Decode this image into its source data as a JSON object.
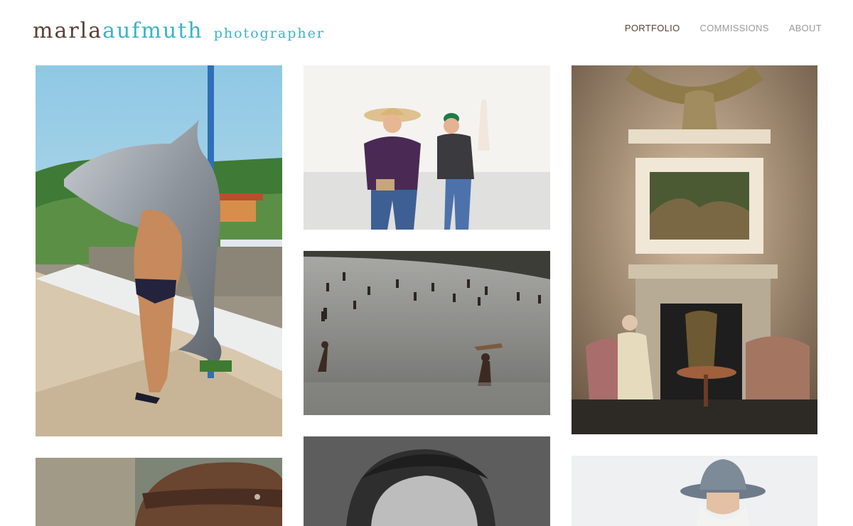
{
  "site": {
    "logo_first": "marla",
    "logo_last": "aufmuth",
    "logo_role": "photographer"
  },
  "nav": [
    {
      "label": "PORTFOLIO",
      "active": true
    },
    {
      "label": "COMMISSIONS",
      "active": false
    },
    {
      "label": "ABOUT",
      "active": false
    }
  ],
  "colors": {
    "accent": "#3bb3c7",
    "brand_dark": "#5a4036",
    "nav_inactive": "#9a9a9a"
  },
  "photos": [
    {
      "subject": "man-with-dolphin-statue"
    },
    {
      "subject": "boys-running-in-cowboy-hats"
    },
    {
      "subject": "people-wading-in-sea"
    },
    {
      "subject": "elderly-woman-in-ornate-room"
    },
    {
      "subject": "brown-fedora-hat"
    },
    {
      "subject": "black-and-white-portrait"
    },
    {
      "subject": "bearded-man-in-cowboy-hat"
    }
  ]
}
